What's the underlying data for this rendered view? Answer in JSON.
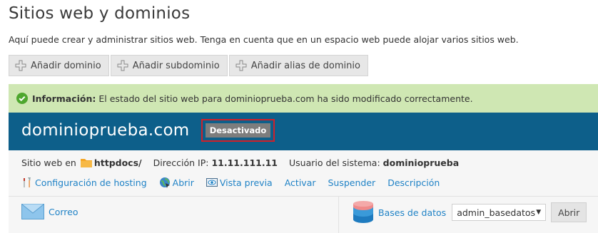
{
  "page": {
    "title": "Sitios web y dominios",
    "subtitle": "Aquí puede crear y administrar sitios web. Tenga en cuenta que en un espacio web puede alojar varios sitios web."
  },
  "toolbar": {
    "add_domain": "Añadir dominio",
    "add_subdomain": "Añadir subdominio",
    "add_alias": "Añadir alias de dominio"
  },
  "alert": {
    "label": "Información:",
    "message": "El estado del sitio web para dominioprueba.com ha sido modificado correctamente.",
    "color": "#cfe7b3"
  },
  "domain": {
    "name": "dominioprueba.com",
    "status": "Desactivado",
    "header_color": "#0d5f8a",
    "highlight_color": "#d0202a"
  },
  "info": {
    "website_label": "Sitio web en",
    "docroot": "httpdocs/",
    "ip_label": "Dirección IP:",
    "ip": "11.11.111.11",
    "user_label": "Usuario del sistema:",
    "user": "dominioprueba"
  },
  "actions": {
    "hosting": "Configuración de hosting",
    "open": "Abrir",
    "preview": "Vista previa",
    "activate": "Activar",
    "suspend": "Suspender",
    "description": "Descripción",
    "link_color": "#1f82c6"
  },
  "bottom": {
    "mail": "Correo",
    "databases": "Bases de datos",
    "db_selected": "admin_basedatos",
    "open_button": "Abrir"
  }
}
